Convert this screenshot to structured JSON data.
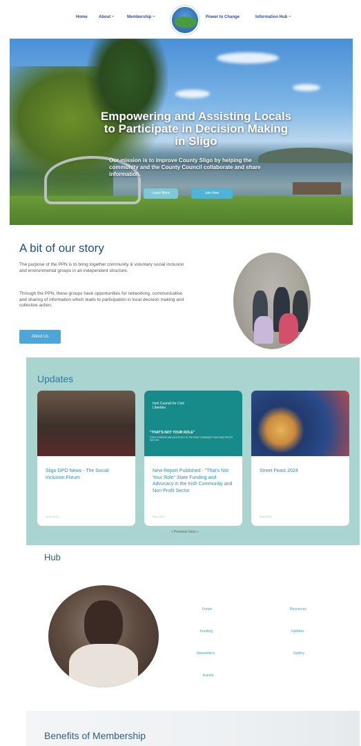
{
  "nav": {
    "items": [
      "Home",
      "About ~",
      "Membership ~",
      "Power to Change",
      "Information Hub ~"
    ]
  },
  "hero": {
    "heading": "Empowering and Assisting Locals to Participate in Decision Making in Sligo",
    "subtext": "Our mission is to improve County Sligo by helping the community and the County Council collaborate and share information.",
    "buttons": [
      "Learn More",
      "Join Now"
    ]
  },
  "story": {
    "title": "A bit of our story",
    "para1": "The purpose of the PPN is to bring together community & voluntary social inclusion and environmental groups in an independent structure.",
    "para2": "Through the PPN, these groups have opportunities for networking, communication and sharing of information which leads to participation in local decision making and collective action.",
    "button": "About Us"
  },
  "updates": {
    "title": "Updates",
    "cards": [
      {
        "title": "Sligo DPO News - The Social Inclusion Forum",
        "date": "June 2024"
      },
      {
        "title": "New Report Published - \"That's Not Your Role\" State Funding and Advocacy in the Irish Community and Non-Profit Sector",
        "date": "May 2024"
      },
      {
        "title": "Street Feast 2024",
        "date": "May 2024"
      }
    ],
    "card2_image": {
      "org": "Irish Council for Civil Liberties",
      "heading": "\"THAT'S NOT YOUR ROLE\"",
      "sub": "STATE FUNDING AND ADVOCACY IN THE IRISH COMMUNITY AND NON-PROFIT SECTOR"
    },
    "pager": "« Previous   Next »"
  },
  "hub": {
    "title": "Hub",
    "links": [
      "Forum",
      "Resources",
      "Funding",
      "Updates",
      "Newsletters",
      "Gallery",
      "Events"
    ]
  },
  "benefits": {
    "title": "Benefits of Membership"
  },
  "colors": {
    "nav_text": "#2f4f9a",
    "primary_blue": "#4ea6d8",
    "teal_band": "#a9d4d0",
    "link": "#3aa2c6"
  }
}
